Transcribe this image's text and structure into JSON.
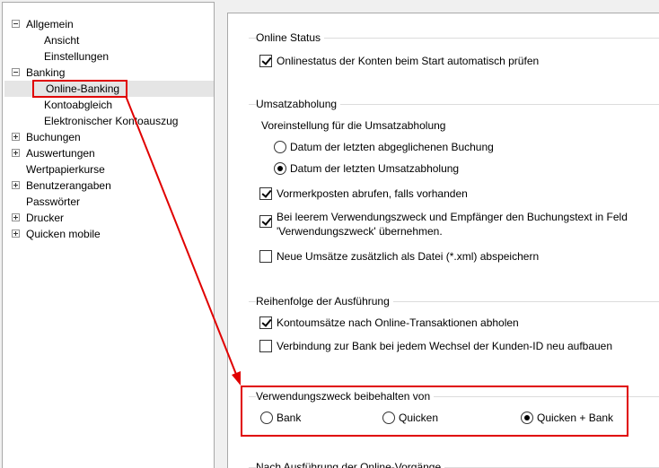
{
  "tree": {
    "items": [
      {
        "label": "Allgemein",
        "expander": "minus"
      },
      {
        "label": "Ansicht"
      },
      {
        "label": "Einstellungen"
      },
      {
        "label": "Banking",
        "expander": "minus"
      },
      {
        "label": "Online-Banking",
        "selected": true
      },
      {
        "label": "Kontoabgleich"
      },
      {
        "label": "Elektronischer Kontoauszug"
      },
      {
        "label": "Buchungen",
        "expander": "plus"
      },
      {
        "label": "Auswertungen",
        "expander": "plus"
      },
      {
        "label": "Wertpapierkurse"
      },
      {
        "label": "Benutzerangaben",
        "expander": "plus"
      },
      {
        "label": "Passwörter"
      },
      {
        "label": "Drucker",
        "expander": "plus"
      },
      {
        "label": "Quicken mobile",
        "expander": "plus"
      }
    ]
  },
  "online_status": {
    "title": "Online Status",
    "auto_check": {
      "label": "Onlinestatus der Konten beim Start automatisch prüfen",
      "checked": true
    }
  },
  "umsatzabholung": {
    "title": "Umsatzabholung",
    "subtitle": "Voreinstellung für die Umsatzabholung",
    "radio_last_reconciled": {
      "label": "Datum der letzten abgeglichenen Buchung",
      "checked": false
    },
    "radio_last_fetch": {
      "label": "Datum der letzten Umsatzabholung",
      "checked": true
    },
    "vormerkposten": {
      "label": "Vormerkposten abrufen, falls vorhanden",
      "checked": true
    },
    "buchungstext_line1": "Bei leerem Verwendungszweck und Empfänger den Buchungstext in Feld",
    "buchungstext_line2": "'Verwendungszweck' übernehmen.",
    "buchungstext_checked": true,
    "save_xml": {
      "label": "Neue Umsätze zusätzlich als Datei (*.xml) abspeichern",
      "checked": false
    }
  },
  "reihenfolge": {
    "title": "Reihenfolge der Ausführung",
    "kontoumsaetze": {
      "label": "Kontoumsätze nach Online-Transaktionen abholen",
      "checked": true
    },
    "verbindung": {
      "label": "Verbindung zur Bank bei jedem Wechsel der Kunden-ID neu aufbauen",
      "checked": false
    }
  },
  "verwendungszweck": {
    "title": "Verwendungszweck beibehalten von",
    "bank": {
      "label": "Bank",
      "checked": false
    },
    "quicken": {
      "label": "Quicken",
      "checked": false
    },
    "quicken_bank": {
      "label": "Quicken + Bank",
      "checked": true
    }
  },
  "nach_ausfuehrung": {
    "title": "Nach Ausführung der Online-Vorgänge"
  },
  "colors": {
    "annotation_red": "#e00000"
  }
}
